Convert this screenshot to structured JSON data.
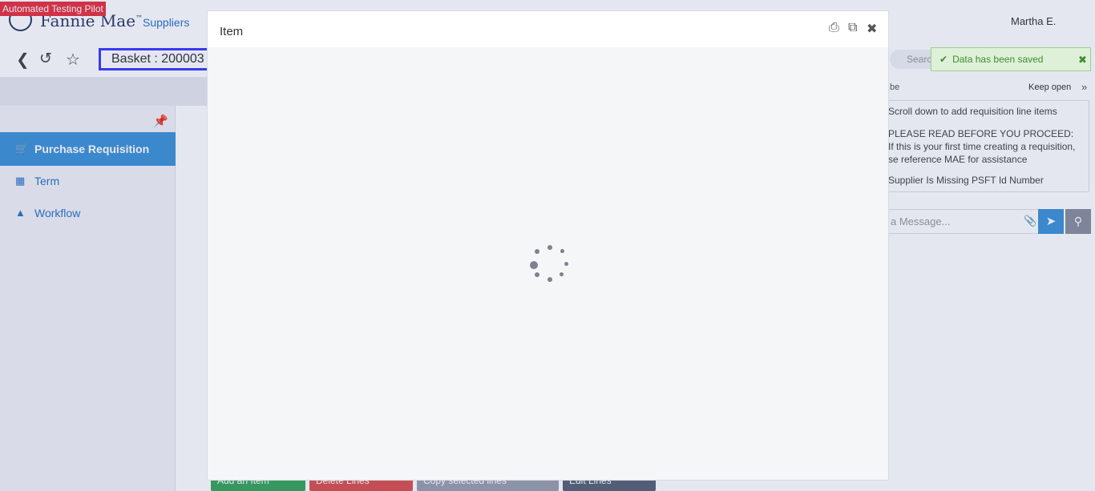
{
  "banner": {
    "label": "Automated Testing Pilot"
  },
  "brand": {
    "name": "Fannie Mae",
    "trademark": "™"
  },
  "nav": {
    "suppliers": "Suppliers"
  },
  "user": {
    "name": "Martha E."
  },
  "toolbar": {
    "basket_label": "Basket : 200003"
  },
  "sidebar": {
    "items": [
      {
        "label": "Purchase Requisition",
        "icon": "basket-icon",
        "active": true
      },
      {
        "label": "Term",
        "icon": "calculator-icon",
        "active": false
      },
      {
        "label": "Workflow",
        "icon": "road-icon",
        "active": false
      }
    ]
  },
  "right_panel": {
    "search_placeholder": "Search",
    "subscribe_label": "be",
    "keep_open_label": "Keep open",
    "messages": [
      "Scroll down to add requisition line items",
      "PLEASE READ BEFORE YOU PROCEED:",
      "If this is your first time creating a requisition,",
      "se reference MAE for assistance",
      "Supplier Is Missing PSFT Id Number"
    ],
    "message_placeholder": "a Message..."
  },
  "toast": {
    "text": "Data has been saved"
  },
  "modal": {
    "title": "Item"
  },
  "bottom_buttons": {
    "add_item": "Add an Item",
    "delete_lines": "Delete Lines",
    "copy_lines": "Copy selected lines",
    "edit_lines": "Edit Lines"
  },
  "colors": {
    "accent": "#3f93d6",
    "banner": "#e8313e",
    "toast_bg": "#dff0d8",
    "toast_text": "#3c8d2f"
  }
}
